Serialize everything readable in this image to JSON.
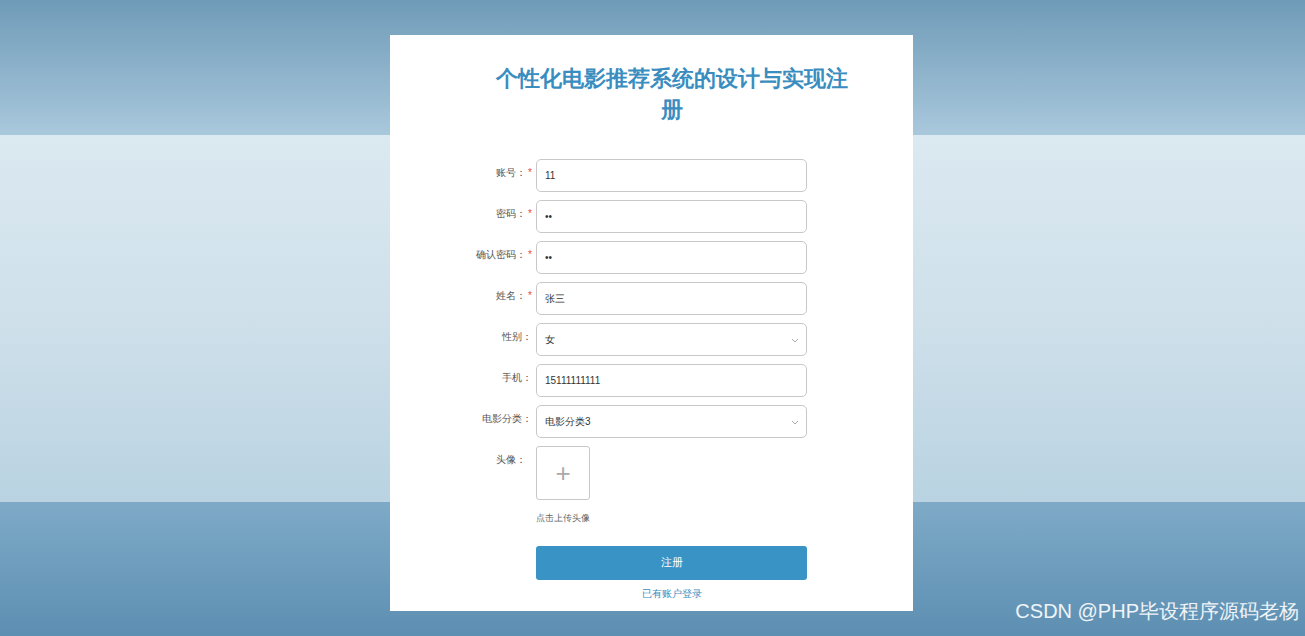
{
  "title": "个性化电影推荐系统的设计与实现注册",
  "required_mark": "*",
  "fields": [
    {
      "label": "账号：",
      "required": true,
      "value": "11",
      "kind": "input"
    },
    {
      "label": "密码：",
      "required": true,
      "value": "••",
      "kind": "input"
    },
    {
      "label": "确认密码：",
      "required": true,
      "value": "••",
      "kind": "input"
    },
    {
      "label": "姓名：",
      "required": true,
      "value": "张三",
      "kind": "input"
    },
    {
      "label": "性别：",
      "required": false,
      "value": "女",
      "kind": "select"
    },
    {
      "label": "手机：",
      "required": false,
      "value": "15111111111",
      "kind": "input"
    },
    {
      "label": "电影分类：",
      "required": false,
      "value": "电影分类3",
      "kind": "select"
    }
  ],
  "avatar": {
    "label": "头像：",
    "plus": "+",
    "hint": "点击上传头像"
  },
  "submit": "注册",
  "login_link": "已有账户登录",
  "watermark": "CSDN @PHP毕设程序源码老杨"
}
